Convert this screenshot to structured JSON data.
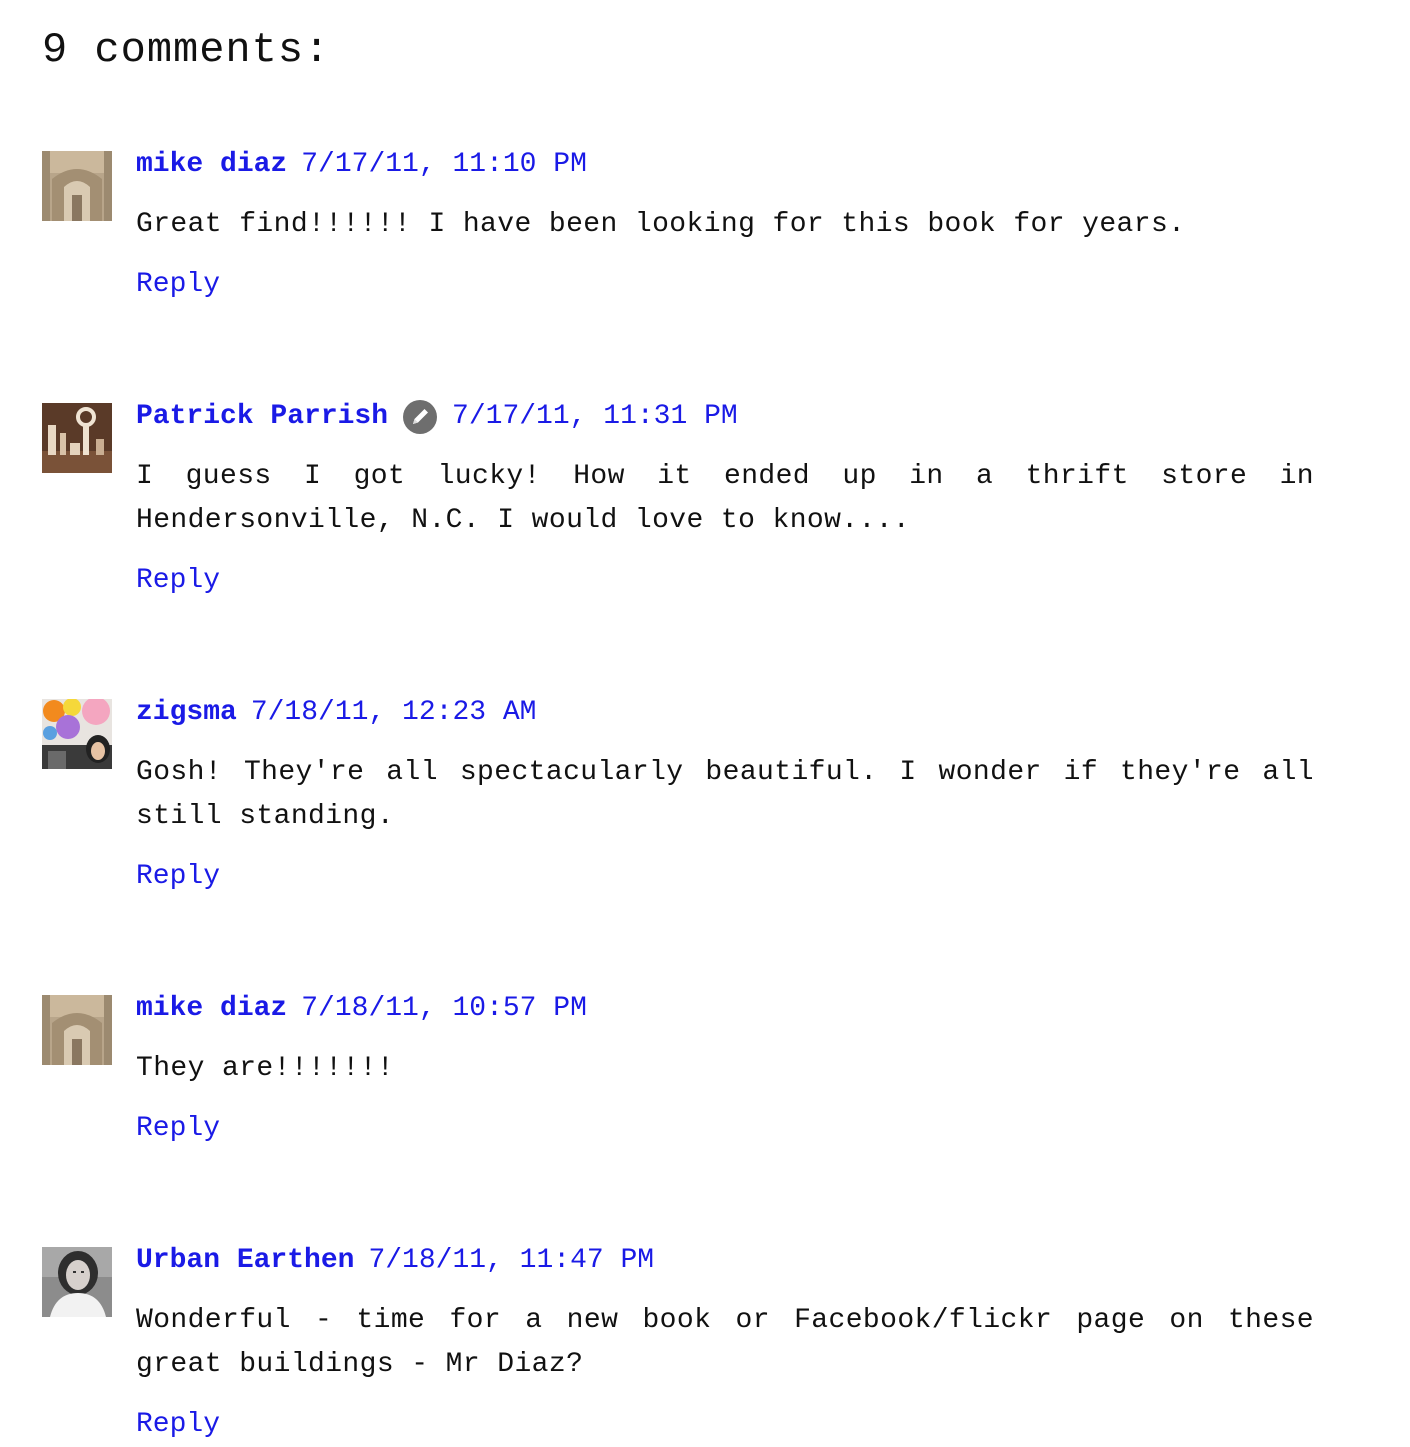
{
  "heading": "9 comments:",
  "colors": {
    "link": "#1a1ae6",
    "text": "#111111",
    "background": "#ffffff"
  },
  "comments": [
    {
      "author": "mike diaz",
      "timestamp": "7/17/11, 11:10 PM",
      "body": "Great find!!!!!! I have been looking for this book for years.",
      "reply": "Reply",
      "avatar": "mike-diaz-avatar",
      "blog_author_badge": false
    },
    {
      "author": "Patrick Parrish",
      "timestamp": "7/17/11, 11:31 PM",
      "body": "I guess I got lucky! How it ended up in a thrift store in Hendersonville, N.C. I would love to know....",
      "reply": "Reply",
      "avatar": "patrick-parrish-avatar",
      "blog_author_badge": true,
      "badge_icon": "pencil-icon"
    },
    {
      "author": "zigsma",
      "timestamp": "7/18/11, 12:23 AM",
      "body": "Gosh! They're all spectacularly beautiful. I wonder if they're all still standing.",
      "reply": "Reply",
      "avatar": "zigsma-avatar",
      "blog_author_badge": false
    },
    {
      "author": "mike diaz",
      "timestamp": "7/18/11, 10:57 PM",
      "body": "They are!!!!!!!",
      "reply": "Reply",
      "avatar": "mike-diaz-avatar",
      "blog_author_badge": false
    },
    {
      "author": "Urban Earthen",
      "timestamp": "7/18/11, 11:47 PM",
      "body": "Wonderful - time for a new book or Facebook/flickr page on these great buildings - Mr Diaz?",
      "reply": "Reply",
      "avatar": "urban-earthen-avatar",
      "blog_author_badge": false
    }
  ]
}
